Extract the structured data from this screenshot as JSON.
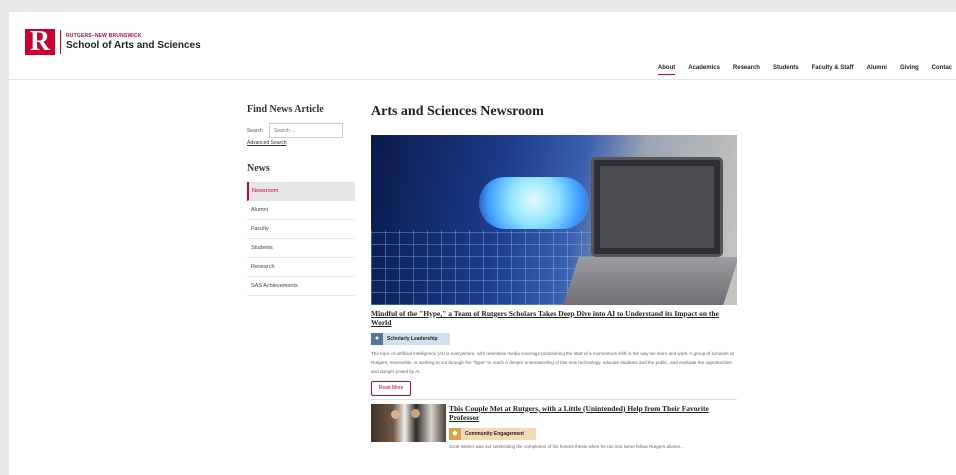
{
  "header": {
    "logo_letter": "R",
    "logo_small": "RUTGERS–NEW BRUNSWICK",
    "logo_big": "School of Arts and Sciences",
    "nav": [
      "About",
      "Academics",
      "Research",
      "Students",
      "Faculty & Staff",
      "Alumni",
      "Giving",
      "Contac"
    ],
    "active_nav": "About"
  },
  "sidebar": {
    "find_heading": "Find News Article",
    "search_label": "Search",
    "search_placeholder": "Search ...",
    "advanced_search": "Advanced Search",
    "news_heading": "News",
    "items": [
      "Newsroom",
      "Alumni",
      "Faculty",
      "Students",
      "Research",
      "SAS Achievements"
    ],
    "active_item": "Newsroom"
  },
  "main": {
    "title": "Arts and Sciences Newsroom",
    "articles": [
      {
        "title": "Mindful of the \"Hype,\" a Team of Rutgers Scholars Takes Deep Dive into AI to Understand its Impact on the World",
        "tag": "Scholarly Leadership",
        "excerpt": "The topic of artificial intelligence (AI) is everywhere, with relentless media coverage proclaiming the start of a momentous shift in the way we learn and work. A group of scholars at Rutgers, meanwhile, is working to cut through the \"hype\" to reach a deeper understanding of this new technology, educate students and the public, and evaluate the opportunities and danger posed by AI.",
        "read_more": "Read More"
      },
      {
        "title": "This Couple Met at Rutgers, with a Little (Unintended) Help from Their Favorite Professor",
        "tag": "Community Engagement",
        "excerpt": "Scott Weber was out celebrating the completion of his honors thesis when he ran into some fellow Rutgers alumni..."
      }
    ]
  },
  "colors": {
    "brand": "#cc0033",
    "tag_scholarly": "#cfe0f0",
    "tag_community": "#f2d9b3"
  },
  "icons": {
    "tag_scholarly": "person-icon",
    "tag_community": "handshake-icon"
  }
}
